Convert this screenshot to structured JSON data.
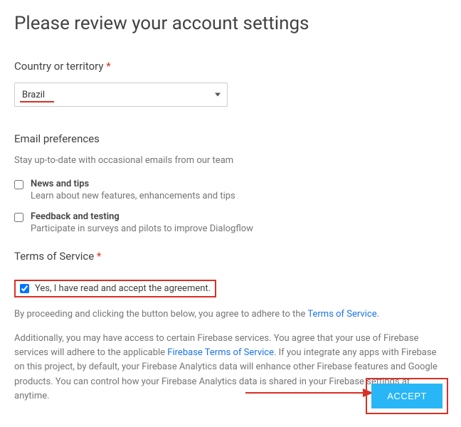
{
  "page": {
    "title": "Please review your account settings"
  },
  "country": {
    "label": "Country or territory",
    "required_marker": "*",
    "selected": "Brazil"
  },
  "email": {
    "heading": "Email preferences",
    "subtext": "Stay up-to-date with occasional emails from our team",
    "options": [
      {
        "title": "News and tips",
        "desc": "Learn about new features, enhancements and tips"
      },
      {
        "title": "Feedback and testing",
        "desc": "Participate in surveys and pilots to improve Dialogflow"
      }
    ]
  },
  "tos": {
    "heading": "Terms of Service",
    "required_marker": "*",
    "agree_label": "Yes, I have read and accept the agreement.",
    "para1_prefix": "By proceeding and clicking the button below, you agree to adhere to the ",
    "para1_link": "Terms of Service",
    "para1_suffix": ".",
    "para2_prefix": "Additionally, you may have access to certain Firebase services. You agree that your use of Firebase services will adhere to the applicable ",
    "para2_link": "Firebase Terms of Service",
    "para2_suffix": ". If you integrate any apps with Firebase on this project, by default, your Firebase Analytics data will enhance other Firebase features and Google products. You can control how your Firebase Analytics data is shared in your Firebase settings at anytime."
  },
  "actions": {
    "accept_label": "ACCEPT"
  }
}
